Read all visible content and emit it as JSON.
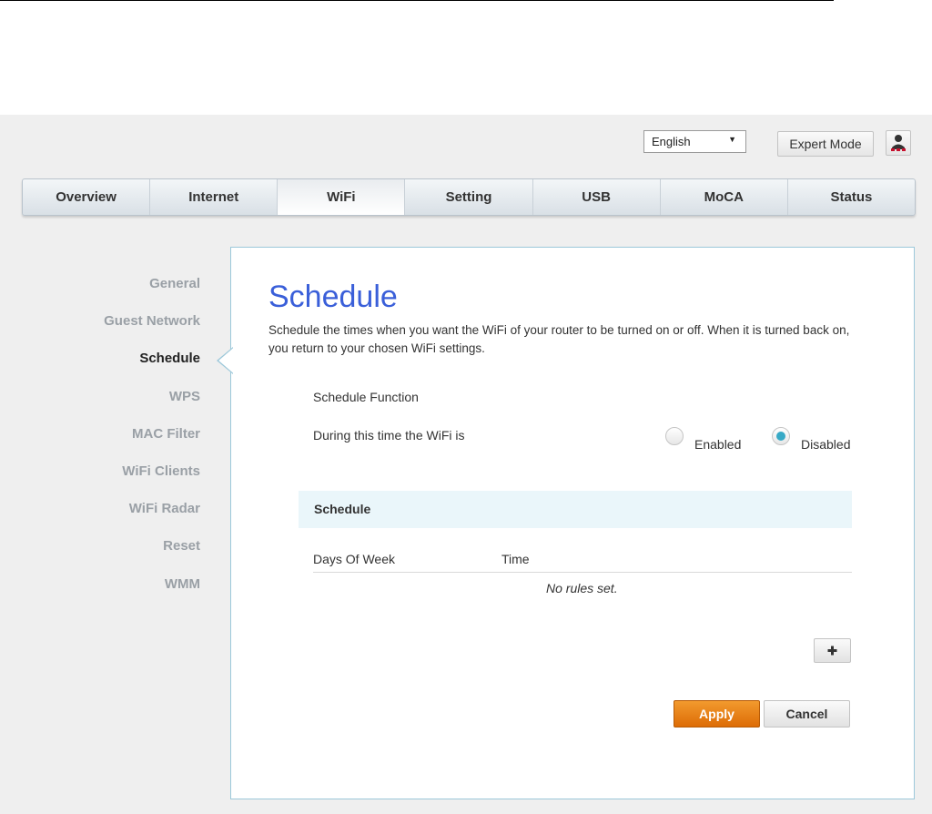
{
  "header": {
    "language": "English",
    "expert_mode_label": "Expert Mode"
  },
  "tabs": [
    {
      "label": "Overview"
    },
    {
      "label": "Internet"
    },
    {
      "label": "WiFi",
      "active": true
    },
    {
      "label": "Setting"
    },
    {
      "label": "USB"
    },
    {
      "label": "MoCA"
    },
    {
      "label": "Status"
    }
  ],
  "sidebar": {
    "items": [
      {
        "label": "General"
      },
      {
        "label": "Guest Network"
      },
      {
        "label": "Schedule",
        "active": true
      },
      {
        "label": "WPS"
      },
      {
        "label": "MAC Filter"
      },
      {
        "label": "WiFi Clients"
      },
      {
        "label": "WiFi Radar"
      },
      {
        "label": "Reset"
      },
      {
        "label": "WMM"
      }
    ]
  },
  "main": {
    "title": "Schedule",
    "description": "Schedule the times when you want the WiFi of your router to be turned on or off. When it is turned back on, you return to your chosen WiFi settings.",
    "schedule_function_label": "Schedule Function",
    "wifi_state_label": "During this time the WiFi is",
    "radio": {
      "enabled_label": "Enabled",
      "disabled_label": "Disabled",
      "selected": "Disabled"
    },
    "section_title": "Schedule",
    "table": {
      "columns": [
        "Days Of Week",
        "Time"
      ],
      "empty_message": "No rules set."
    },
    "add_label": "+",
    "apply_label": "Apply",
    "cancel_label": "Cancel"
  },
  "colors": {
    "title_blue": "#3a5fd9",
    "apply_orange": "#e57b12",
    "radio_selected": "#37a9c6",
    "panel_border": "#9cc8da"
  }
}
